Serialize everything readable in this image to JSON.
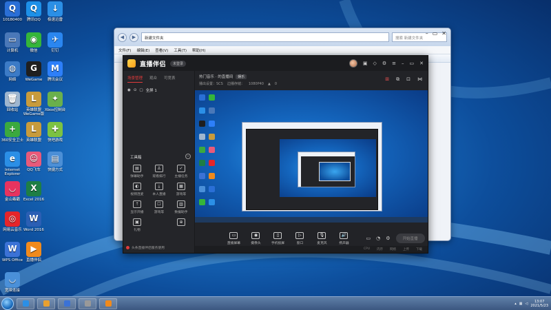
{
  "desktop": {
    "icons": [
      {
        "label": "10180400",
        "color": "#2a6fd6",
        "glyph": "Q"
      },
      {
        "label": "腾讯QQ",
        "color": "#1d90e8",
        "glyph": "Q"
      },
      {
        "label": "极速迅雷",
        "color": "#2b8fe6",
        "glyph": "↓"
      },
      {
        "label": "计算机",
        "color": "#4a78b8",
        "glyph": "▭"
      },
      {
        "label": "微信",
        "color": "#35b53a",
        "glyph": "◉"
      },
      {
        "label": "钉钉",
        "color": "#2a86f0",
        "glyph": "✈"
      },
      {
        "label": "网络",
        "color": "#3c7bc6",
        "glyph": "◍"
      },
      {
        "label": "WeGame",
        "color": "#1f1f1f",
        "glyph": "G"
      },
      {
        "label": "腾讯会议",
        "color": "#2d7ff9",
        "glyph": "M"
      },
      {
        "label": "回收站",
        "color": "#9fb6cf",
        "glyph": "🗑"
      },
      {
        "label": "英雄联盟WeGame版",
        "color": "#c89b3c",
        "glyph": "L"
      },
      {
        "label": "Xbox控制台",
        "color": "#6ab04c",
        "glyph": "✦"
      },
      {
        "label": "360安全卫士",
        "color": "#3ba93f",
        "glyph": "+"
      },
      {
        "label": "英雄联盟",
        "color": "#c89b3c",
        "glyph": "L"
      },
      {
        "label": "快吧游戏",
        "color": "#7cc242",
        "glyph": "✚"
      },
      {
        "label": "Internet Explorer",
        "color": "#2b8fe6",
        "glyph": "e"
      },
      {
        "label": "QQ飞车",
        "color": "#e85a7a",
        "glyph": "☺"
      },
      {
        "label": "快捷方式",
        "color": "#4c8fd6",
        "glyph": "▤"
      },
      {
        "label": "金山毒霸",
        "color": "#e8335f",
        "glyph": "◡"
      },
      {
        "label": "Excel 2016",
        "color": "#1e7e45",
        "glyph": "X"
      },
      {
        "label": "网易云音乐",
        "color": "#e5252a",
        "glyph": "◎"
      },
      {
        "label": "Word 2016",
        "color": "#2b5fb4",
        "glyph": "W"
      },
      {
        "label": "WPS Office",
        "color": "#3b72d6",
        "glyph": "W"
      },
      {
        "label": "直播伴侣",
        "color": "#f08a1c",
        "glyph": "▶"
      },
      {
        "label": "宽带连接",
        "color": "#4a90d9",
        "glyph": "◡"
      }
    ]
  },
  "explorer": {
    "address": "新建文件夹",
    "search_placeholder": "搜索 新建文件夹",
    "menu": [
      "文件(F)",
      "编辑(E)",
      "查看(V)",
      "工具(T)",
      "帮助(H)"
    ]
  },
  "app": {
    "logo": "直播伴侣",
    "login_pill": "未登录",
    "left_tabs": [
      "场景管理",
      "观众",
      "可竞表"
    ],
    "scene": "全屏 1",
    "toolbox_title": "工具箱",
    "tools": [
      {
        "label": "弹幕助手",
        "icon": "▤"
      },
      {
        "label": "观看排行",
        "icon": "♙"
      },
      {
        "label": "主播任务",
        "icon": "✓"
      },
      {
        "label": "视频连麦",
        "icon": "◐"
      },
      {
        "label": "本人直播",
        "icon": "⤓"
      },
      {
        "label": "游戏等",
        "icon": "▦"
      },
      {
        "label": "显示开播",
        "icon": "⇡"
      },
      {
        "label": "游戏等",
        "icon": "☐"
      },
      {
        "label": "数据助手",
        "icon": "▥"
      },
      {
        "label": "礼物",
        "icon": "▣"
      },
      {
        "label": "",
        "icon": ""
      },
      {
        "label": "",
        "icon": "⊕"
      }
    ],
    "bottom_note": "头条直播伴侣服务使用",
    "title_line": "热门音乐 · 的直播间",
    "category": "娱乐",
    "sub_line_1": "播出设置：SCS",
    "sub_line_2": "边播存储：",
    "sub_line_3": "1080P40",
    "sub_line_4": "0",
    "controls": [
      {
        "label": "直播屏幕",
        "icon": "▭"
      },
      {
        "label": "摄像头",
        "icon": "◉"
      },
      {
        "label": "手机投屏",
        "icon": "▯"
      },
      {
        "label": "窗口",
        "icon": "▷"
      },
      {
        "label": "麦克风",
        "icon": "🎙"
      },
      {
        "label": "扬声器",
        "icon": "🔊"
      }
    ],
    "live_button": "开始直播",
    "status_items": [
      "CPU",
      "内存",
      "网络",
      "上传",
      "下载"
    ]
  },
  "taskbar": {
    "time": "13:07",
    "date": "2021/5/23",
    "apps": [
      {
        "color": "#2b8fe6"
      },
      {
        "color": "#e8a030"
      },
      {
        "color": "#3b72d6"
      },
      {
        "color": "#999999"
      },
      {
        "color": "#f08a1c"
      }
    ]
  },
  "colors": {
    "accent_red": "#e23b3b",
    "desktop_blue": "#1c74c8",
    "app_bg": "#222327"
  }
}
